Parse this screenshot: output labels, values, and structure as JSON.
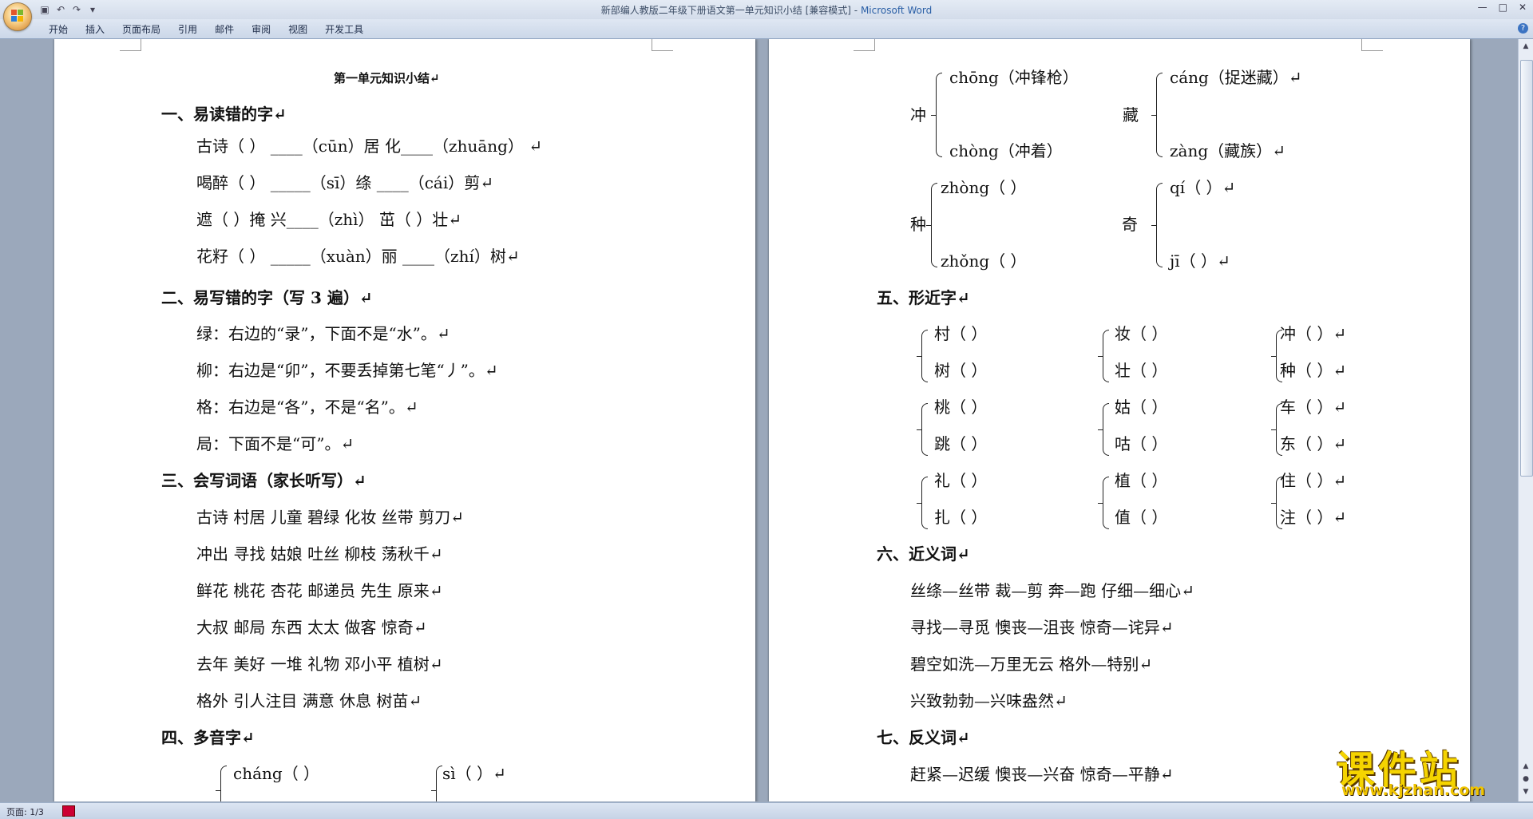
{
  "window": {
    "title": "新部编人教版二年级下册语文第一单元知识小结 [兼容模式]",
    "app_name": "Microsoft Word",
    "controls": [
      "—",
      "□",
      "✕"
    ]
  },
  "ribbon": {
    "tabs": [
      "开始",
      "插入",
      "页面布局",
      "引用",
      "邮件",
      "审阅",
      "视图",
      "开发工具"
    ]
  },
  "status": {
    "page": "页面: 1/3"
  },
  "watermark": {
    "brand": "课件站",
    "url": "www.kjzhan.com"
  },
  "page1": {
    "title": "第一单元知识小结↵",
    "s1_heading": "一、易读错的字↵",
    "s1_rows": [
      "古诗（ ）          ____（cūn）居       化____（zhuāng）  ↵",
      "喝醉（ ）        _____（sī）绦         ____（cái）剪↵",
      "遮（    ）掩        兴____（zhì）     茁（    ）壮↵",
      "花籽（    ）         _____（xuàn）丽     ____（zhí）树↵"
    ],
    "s2_heading": "二、易写错的字（写 3 遍）↵",
    "s2_rows": [
      "绿：右边的“录”，下面不是“水”。↵",
      "柳：右边是“卯”，不要丢掉第七笔“丿”。↵",
      "格：右边是“各”，不是“名”。↵",
      "局：下面不是“可”。↵"
    ],
    "s3_heading": "三、会写词语（家长听写）↵",
    "s3_rows": [
      "古诗    村居    儿童    碧绿    化妆    丝带     剪刀↵",
      "冲出    寻找    姑娘    吐丝    柳枝    荡秋千↵",
      "鲜花    桃花  杏花     邮递员  先生      原来↵",
      "大叔    邮局    东西    太太    做客     惊奇↵",
      "去年    美好    一堆    礼物    邓小平     植树↵",
      "格外    引人注目    满意    休息    树苗↵"
    ],
    "s4_heading": "四、多音字↵",
    "s4_items": [
      "cháng（    ）",
      "sì（    ）↵"
    ]
  },
  "page2": {
    "poly": [
      {
        "char": "冲",
        "top": "chōng（冲锋枪）",
        "bottom": "chòng（冲着）"
      },
      {
        "char": "藏",
        "top": "cáng（捉迷藏）↵",
        "bottom": "zàng（藏族）↵"
      },
      {
        "char": "种",
        "top": "zhòng（     ）",
        "bottom": "zhǒng（     ）"
      },
      {
        "char": "奇",
        "top": "qí（      ）↵",
        "bottom": "jī（       ）↵"
      }
    ],
    "s5_heading": "五、形近字↵",
    "s5_groups": [
      [
        "村（     ）",
        "树（     ）"
      ],
      [
        "妆（     ）",
        "壮（     ）"
      ],
      [
        "冲（     ）↵",
        "种（     ）↵"
      ],
      [
        "桃（     ）",
        "跳（     ）"
      ],
      [
        "姑（     ）",
        "咕（     ）"
      ],
      [
        "车（     ）↵",
        "东（     ）↵"
      ],
      [
        "礼（     ）",
        "扎（     ）"
      ],
      [
        "植（     ）",
        "值（     ）"
      ],
      [
        "住（     ）↵",
        "注（     ）↵"
      ]
    ],
    "s6_heading": "六、近义词↵",
    "s6_rows": [
      "丝绦—丝带      裁—剪       奔—跑       仔细—细心↵",
      "寻找—寻觅      懊丧—沮丧      惊奇—诧异↵",
      "碧空如洗—万里无云        格外—特别↵",
      "兴致勃勃—兴味盎然↵"
    ],
    "s7_heading": "七、反义词↵",
    "s7_rows": [
      "赶紧—迟缓      懊丧—兴奋      惊奇—平静↵"
    ]
  }
}
